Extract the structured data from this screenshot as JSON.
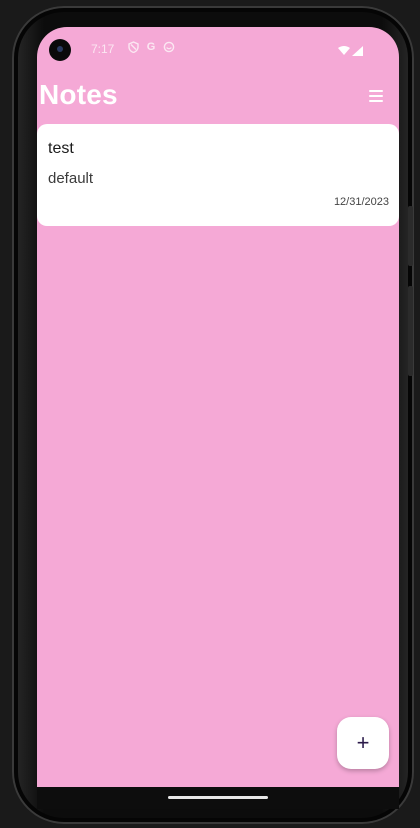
{
  "status_bar": {
    "time": "7:17",
    "left_icons": [
      "shield-icon",
      "google-icon",
      "face-icon"
    ],
    "google_glyph": "G",
    "right_icons": [
      "wifi-icon",
      "signal-icon"
    ]
  },
  "header": {
    "title": "Notes",
    "menu_icon": "hamburger-menu-icon"
  },
  "notes": [
    {
      "title": "test",
      "category": "default",
      "date": "12/31/2023"
    }
  ],
  "fab": {
    "label": "+",
    "icon": "add-icon"
  },
  "colors": {
    "background": "#f5a9d6",
    "card": "#ffffff",
    "header_text": "#ffffff",
    "fab_icon": "#2b1a4a"
  }
}
